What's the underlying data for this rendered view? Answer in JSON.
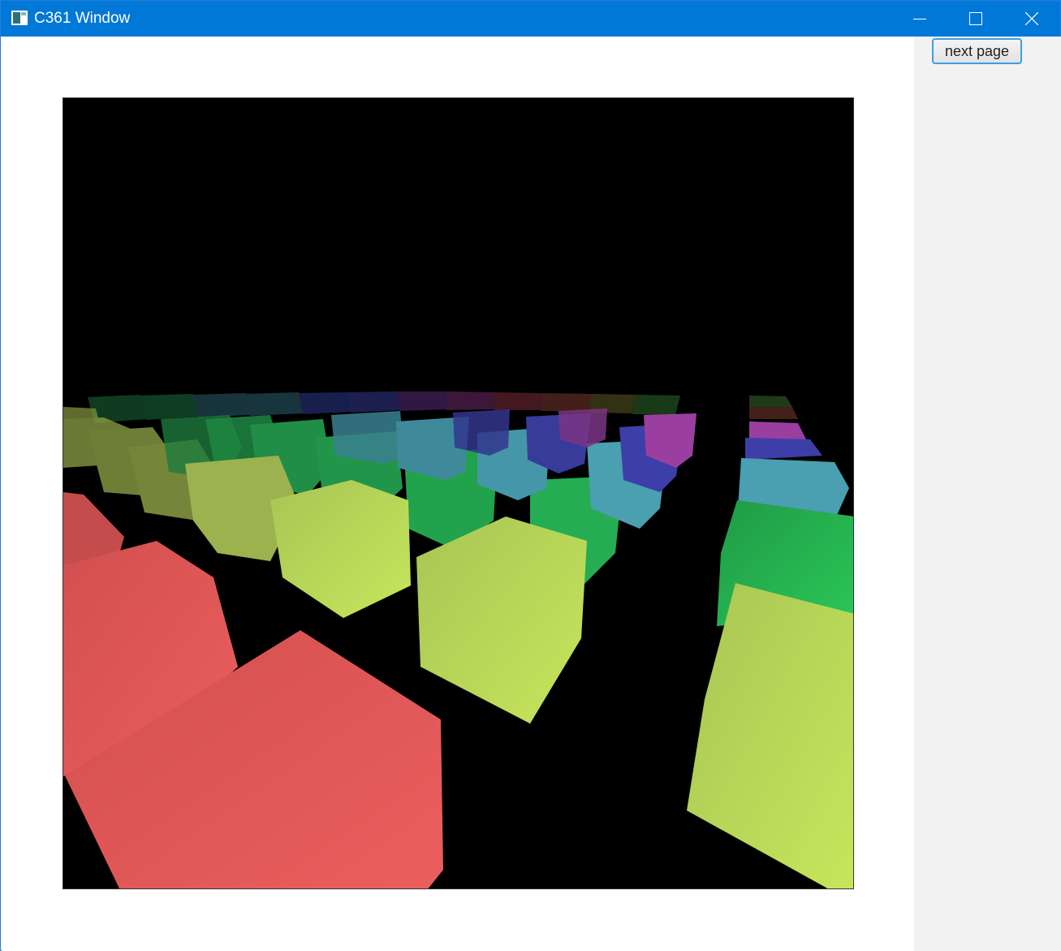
{
  "window": {
    "title": "C361 Window",
    "icon": "app-window-icon",
    "controls": [
      "minimize-icon",
      "maximize-icon",
      "close-icon"
    ],
    "title_bar_color": "#0078d7"
  },
  "sidebar": {
    "next_page_label": "next page",
    "background": "#f2f2f2"
  },
  "scene": {
    "description_type": "3d-rendered-cubes",
    "background_color": "#000000",
    "cube_colors": [
      "#e85b5b",
      "#b5d257",
      "#22b14c",
      "#4a9fb0",
      "#3e3ea8",
      "#9a3fa0"
    ]
  }
}
